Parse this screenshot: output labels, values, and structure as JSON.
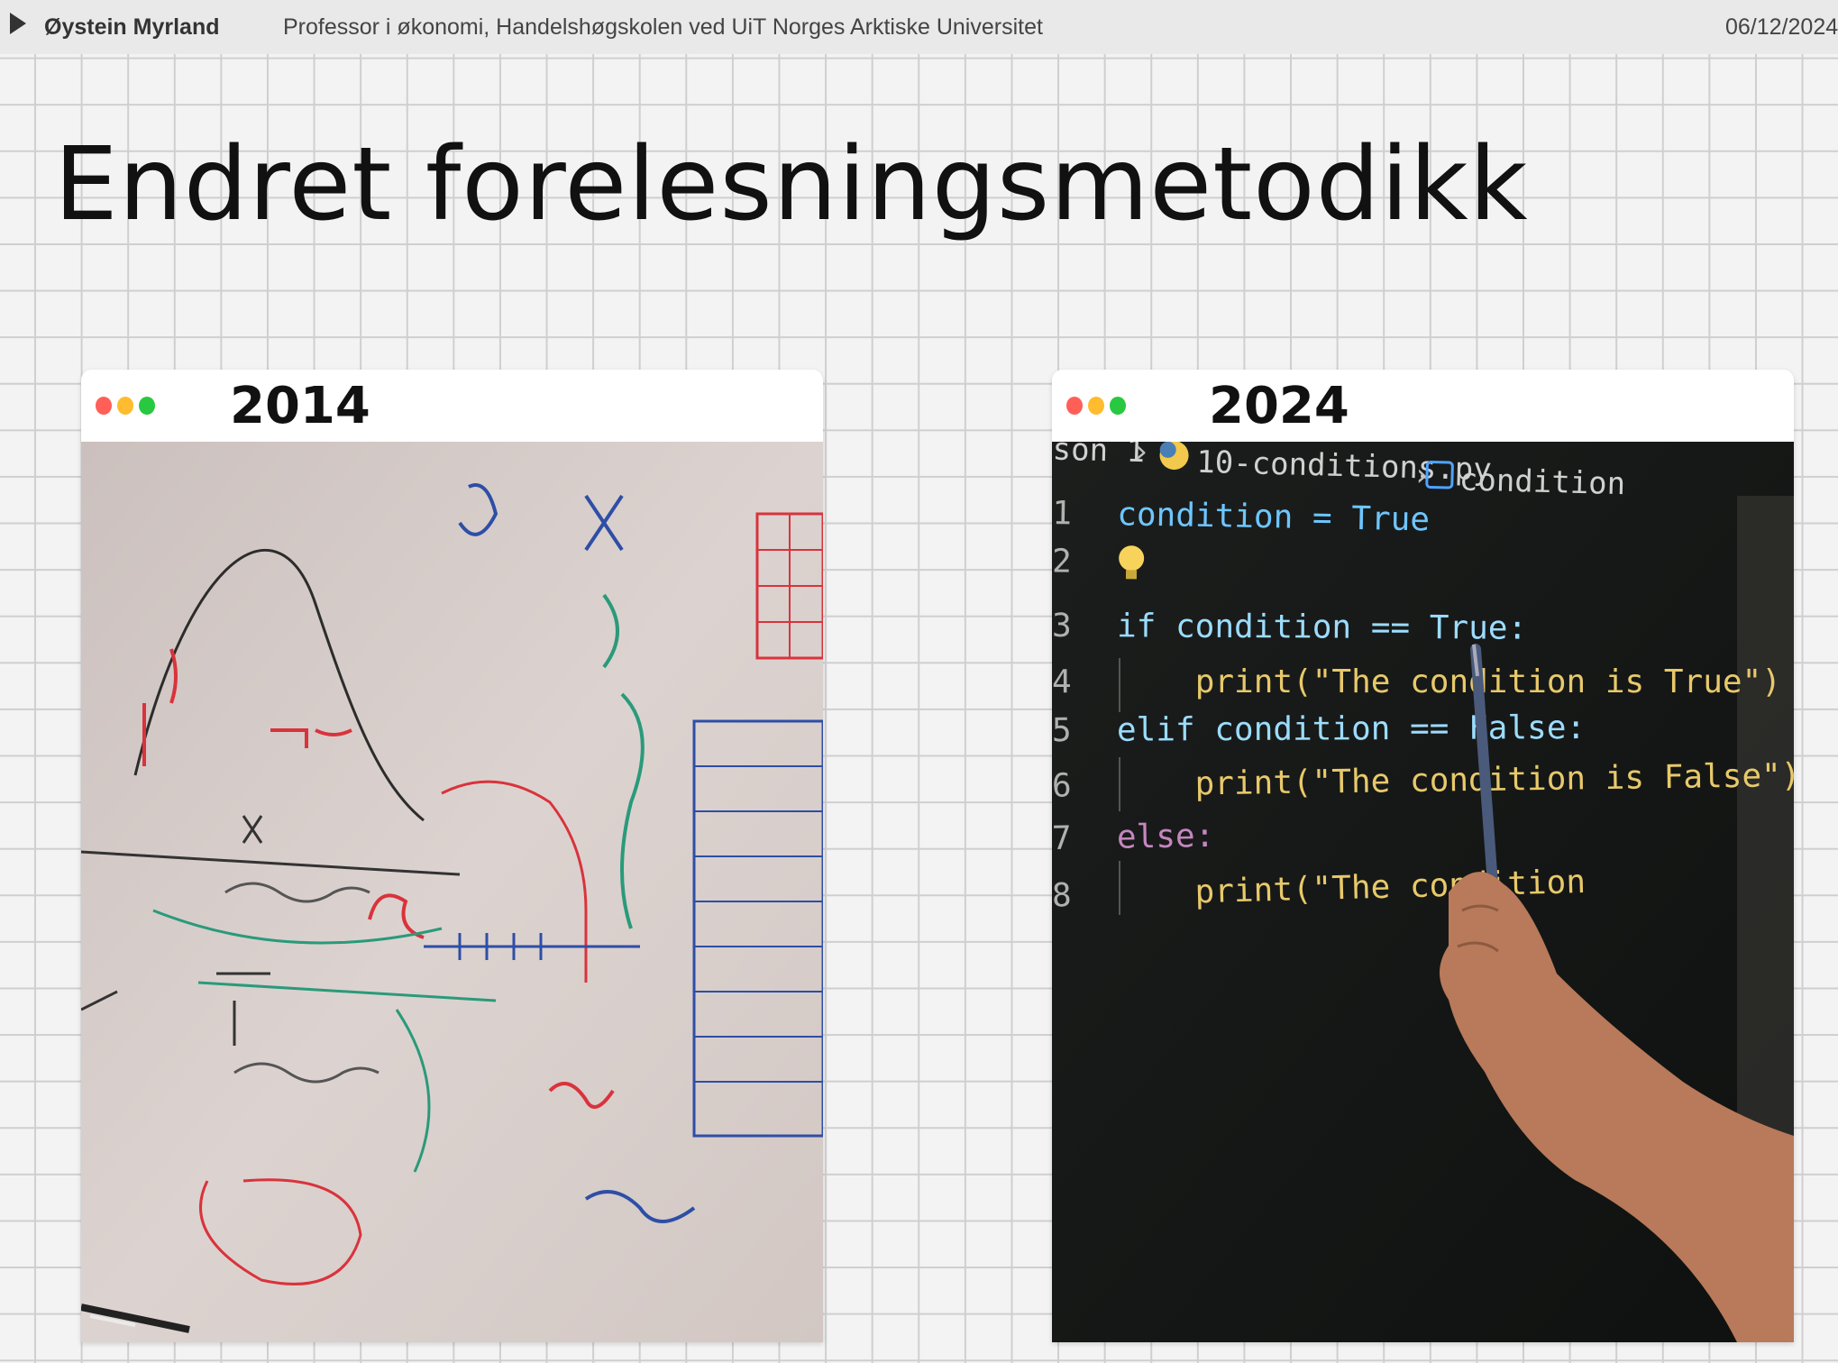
{
  "header": {
    "author": "Øystein Myrland",
    "affiliation": "Professor i økonomi, Handelshøgskolen ved UiT Norges Arktiske Universitet",
    "date": "06/12/2024"
  },
  "slide": {
    "title": "Endret forelesningsmetodikk"
  },
  "cards": [
    {
      "year": "2014",
      "image_icon": "whiteboard-math-photo"
    },
    {
      "year": "2024",
      "image_icon": "code-screen-photo",
      "code": {
        "breadcrumb_prefix": "son 1",
        "file": "10-conditions.py",
        "symbol": "condition",
        "lines": [
          {
            "num": "1",
            "text": "condition = True"
          },
          {
            "num": "2",
            "text": ""
          },
          {
            "num": "3",
            "text": "if condition == True:"
          },
          {
            "num": "4",
            "text": "    print(\"The condition is True\")"
          },
          {
            "num": "5",
            "text": "elif condition == False:"
          },
          {
            "num": "6",
            "text": "    print(\"The condition is False\")"
          },
          {
            "num": "7",
            "text": "else:"
          },
          {
            "num": "8",
            "text": "    print(\"The condition"
          }
        ]
      }
    }
  ],
  "colors": {
    "dot_red": "#ff5f57",
    "dot_yellow": "#febc2e",
    "dot_green": "#28c840",
    "code_keyword": "#c586c0",
    "code_identifier": "#9cdcfe",
    "code_constant": "#4ec9b0",
    "code_function": "#dcdcaa",
    "code_string": "#ce9178",
    "screen_bg": "#1a1c1b"
  }
}
